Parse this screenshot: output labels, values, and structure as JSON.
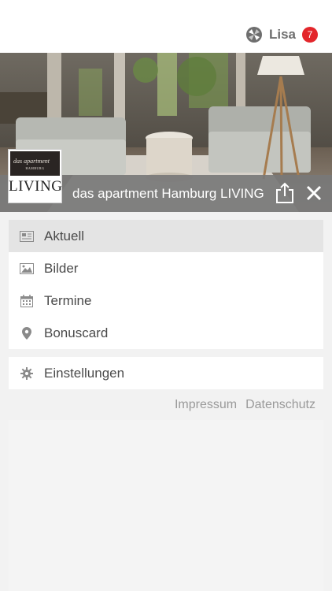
{
  "header": {
    "user_name": "Lisa",
    "notification_count": "7",
    "user_icon": "community-logo-icon"
  },
  "hero": {
    "image_description_icon": "lounge-photo",
    "title": "das apartment Hamburg LIVING"
  },
  "logo": {
    "top_text": "das apartment",
    "top_subtext": "HAMBURG",
    "bottom_text": "LIVING"
  },
  "menu": {
    "items": [
      {
        "label": "Aktuell",
        "icon": "newspaper-icon",
        "active": true
      },
      {
        "label": "Bilder",
        "icon": "image-icon",
        "active": false
      },
      {
        "label": "Termine",
        "icon": "calendar-icon",
        "active": false
      },
      {
        "label": "Bonuscard",
        "icon": "map-pin-icon",
        "active": false
      }
    ]
  },
  "settings": {
    "label": "Einstellungen",
    "icon": "gear-icon"
  },
  "footer": {
    "impressum": "Impressum",
    "datenschutz": "Datenschutz"
  },
  "colors": {
    "badge": "#e3262b",
    "titlebar": "#787878",
    "active_row": "#e4e4e4"
  }
}
